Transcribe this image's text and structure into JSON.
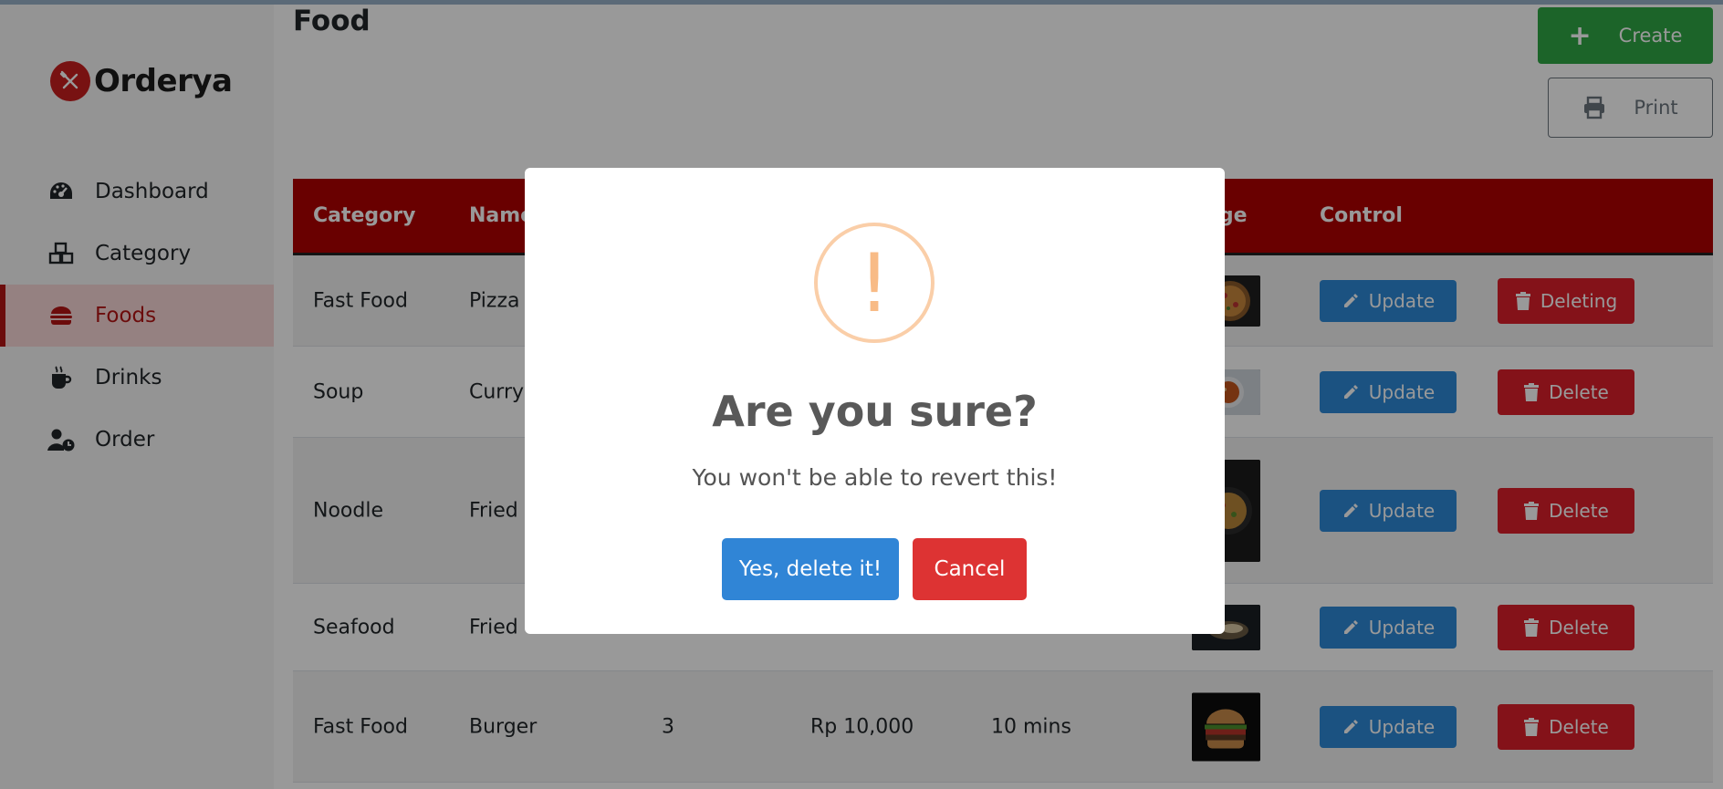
{
  "app": {
    "name": "Orderya"
  },
  "sidebar": {
    "items": [
      {
        "label": "Dashboard",
        "icon": "speedometer-icon"
      },
      {
        "label": "Category",
        "icon": "boxes-icon"
      },
      {
        "label": "Foods",
        "icon": "burger-icon",
        "active": true
      },
      {
        "label": "Drinks",
        "icon": "coffee-cup-icon"
      },
      {
        "label": "Order",
        "icon": "user-clock-icon"
      }
    ]
  },
  "page": {
    "title": "Food"
  },
  "toolbar": {
    "create_label": "Create",
    "print_label": "Print"
  },
  "table": {
    "headers": {
      "category": "Category",
      "name": "Name",
      "image": "age",
      "control": "Control"
    },
    "rows": [
      {
        "category": "Fast Food",
        "name": "Pizza",
        "qty": "",
        "price": "",
        "time": "",
        "update": "Update",
        "delete": "Deleting"
      },
      {
        "category": "Soup",
        "name": "Curry",
        "qty": "",
        "price": "",
        "time": "",
        "update": "Update",
        "delete": "Delete"
      },
      {
        "category": "Noodle",
        "name": "Fried",
        "qty": "",
        "price": "",
        "time": "",
        "update": "Update",
        "delete": "Delete"
      },
      {
        "category": "Seafood",
        "name": "Fried",
        "qty": "",
        "price": "",
        "time": "",
        "update": "Update",
        "delete": "Delete"
      },
      {
        "category": "Fast Food",
        "name": "Burger",
        "qty": "3",
        "price": "Rp 10,000",
        "time": "10 mins",
        "update": "Update",
        "delete": "Delete"
      }
    ]
  },
  "dialog": {
    "icon": "!",
    "title": "Are you sure?",
    "text": "You won't be able to revert this!",
    "confirm_label": "Yes, delete it!",
    "cancel_label": "Cancel"
  },
  "colors": {
    "brand": "#b00000",
    "create": "#2fa745",
    "update": "#2d89d8",
    "delete": "#dc1f2a",
    "confirm": "#3085d6",
    "cancel": "#dd3333",
    "warning": "#f8bb86"
  }
}
